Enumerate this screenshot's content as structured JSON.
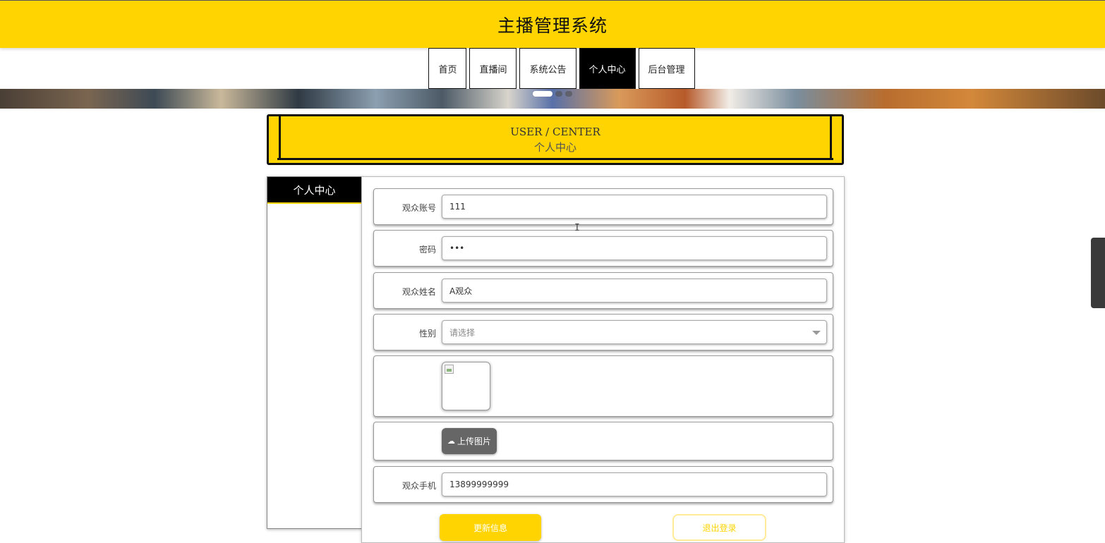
{
  "header": {
    "title": "主播管理系统"
  },
  "nav": {
    "items": [
      {
        "label": "首页",
        "active": false
      },
      {
        "label": "直播间",
        "active": false
      },
      {
        "label": "系统公告",
        "active": false
      },
      {
        "label": "个人中心",
        "active": true
      },
      {
        "label": "后台管理",
        "active": false
      }
    ]
  },
  "section": {
    "title_en": "USER / CENTER",
    "title_cn": "个人中心"
  },
  "sidebar": {
    "title": "个人中心"
  },
  "form": {
    "account": {
      "label": "观众账号",
      "value": "111"
    },
    "password": {
      "label": "密码",
      "value": "•••"
    },
    "name": {
      "label": "观众姓名",
      "value": "A观众"
    },
    "gender": {
      "label": "性别",
      "placeholder": "请选择"
    },
    "upload_label": "上传图片",
    "phone": {
      "label": "观众手机",
      "value": "13899999999"
    }
  },
  "actions": {
    "update": "更新信息",
    "logout": "退出登录"
  },
  "colors": {
    "accent": "#FFD400",
    "nav_active_bg": "#000000"
  },
  "icons": {
    "upload": "cloud-upload-icon",
    "select": "chevron-down-icon"
  }
}
